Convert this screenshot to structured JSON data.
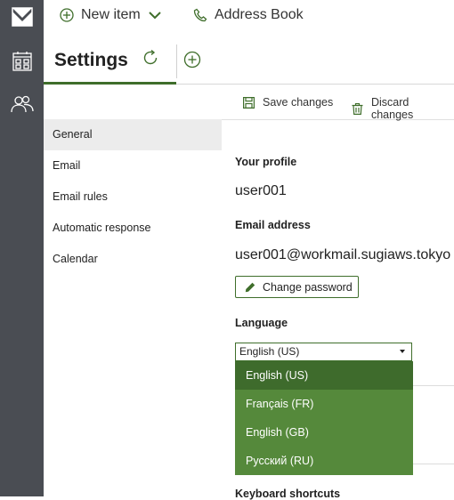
{
  "topbar": {
    "new_item_label": "New item",
    "address_book_label": "Address Book"
  },
  "tab": {
    "title": "Settings"
  },
  "actions": {
    "save_label": "Save changes",
    "discard_label": "Discard changes"
  },
  "sidebar": {
    "items": [
      {
        "label": "General"
      },
      {
        "label": "Email"
      },
      {
        "label": "Email rules"
      },
      {
        "label": "Automatic response"
      },
      {
        "label": "Calendar"
      }
    ]
  },
  "profile": {
    "profile_heading": "Your profile",
    "username": "user001",
    "email_heading": "Email address",
    "email": "user001@workmail.sugiaws.tokyo",
    "change_password_label": "Change password",
    "language_heading": "Language",
    "language_selected": "English (US)",
    "language_options": [
      {
        "label": "English (US)"
      },
      {
        "label": "Français (FR)"
      },
      {
        "label": "English (GB)"
      },
      {
        "label": "Русский (RU)"
      }
    ],
    "keyboard_heading": "Keyboard shortcuts"
  },
  "colors": {
    "accent": "#3f6e2b",
    "dropdown_bg": "#55893b",
    "dropdown_selected": "#3e6b2c",
    "rail_bg": "#4a4d53"
  }
}
